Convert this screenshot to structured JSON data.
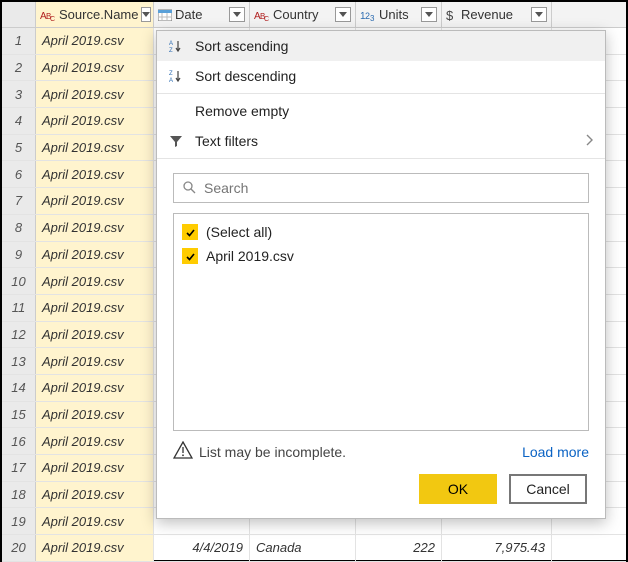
{
  "columns": {
    "source": "Source.Name",
    "date": "Date",
    "country": "Country",
    "units": "Units",
    "revenue": "Revenue"
  },
  "rows": [
    {
      "n": "1",
      "source": "April 2019.csv"
    },
    {
      "n": "2",
      "source": "April 2019.csv"
    },
    {
      "n": "3",
      "source": "April 2019.csv"
    },
    {
      "n": "4",
      "source": "April 2019.csv"
    },
    {
      "n": "5",
      "source": "April 2019.csv"
    },
    {
      "n": "6",
      "source": "April 2019.csv"
    },
    {
      "n": "7",
      "source": "April 2019.csv"
    },
    {
      "n": "8",
      "source": "April 2019.csv"
    },
    {
      "n": "9",
      "source": "April 2019.csv"
    },
    {
      "n": "10",
      "source": "April 2019.csv"
    },
    {
      "n": "11",
      "source": "April 2019.csv"
    },
    {
      "n": "12",
      "source": "April 2019.csv"
    },
    {
      "n": "13",
      "source": "April 2019.csv"
    },
    {
      "n": "14",
      "source": "April 2019.csv"
    },
    {
      "n": "15",
      "source": "April 2019.csv"
    },
    {
      "n": "16",
      "source": "April 2019.csv"
    },
    {
      "n": "17",
      "source": "April 2019.csv"
    },
    {
      "n": "18",
      "source": "April 2019.csv"
    },
    {
      "n": "19",
      "source": "April 2019.csv"
    },
    {
      "n": "20",
      "source": "April 2019.csv",
      "date": "4/4/2019",
      "country": "Canada",
      "units": "222",
      "revenue": "7,975.43"
    }
  ],
  "menu": {
    "sort_asc": "Sort ascending",
    "sort_desc": "Sort descending",
    "remove_empty": "Remove empty",
    "text_filters": "Text filters",
    "search_placeholder": "Search",
    "select_all": "(Select all)",
    "option1": "April 2019.csv",
    "warn": "List may be incomplete.",
    "load_more": "Load more",
    "ok": "OK",
    "cancel": "Cancel"
  }
}
